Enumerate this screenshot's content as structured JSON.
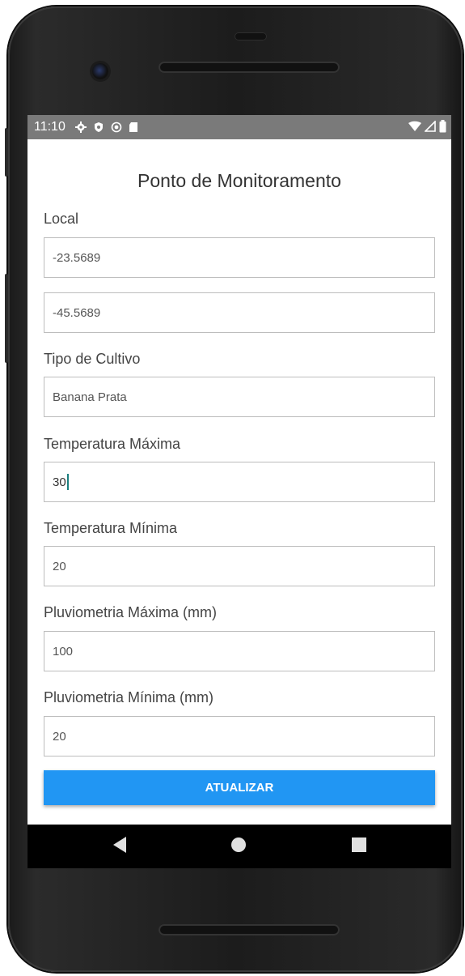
{
  "status_bar": {
    "time": "11:10",
    "left_icons": [
      "gear-icon",
      "shield-icon",
      "circle-record-icon",
      "sd-card-icon"
    ],
    "right_icons": [
      "wifi-icon",
      "signal-icon",
      "battery-icon"
    ]
  },
  "form": {
    "title": "Ponto de Monitoramento",
    "local_label": "Local",
    "latitude_value": "-23.5689",
    "longitude_value": "-45.5689",
    "crop_label": "Tipo de Cultivo",
    "crop_value": "Banana Prata",
    "temp_max_label": "Temperatura Máxima",
    "temp_max_value": "30",
    "temp_min_label": "Temperatura Mínima",
    "temp_min_value": "20",
    "rain_max_label": "Pluviometria Máxima (mm)",
    "rain_max_value": "100",
    "rain_min_label": "Pluviometria Mínima (mm)",
    "rain_min_value": "20",
    "submit_label": "ATUALIZAR"
  },
  "colors": {
    "primary_button": "#2196f3",
    "status_bar": "#7a7a7a",
    "cursor": "#1a7f7f"
  },
  "nav_bar": {
    "icons": [
      "back-triangle-icon",
      "home-circle-icon",
      "recents-square-icon"
    ]
  }
}
